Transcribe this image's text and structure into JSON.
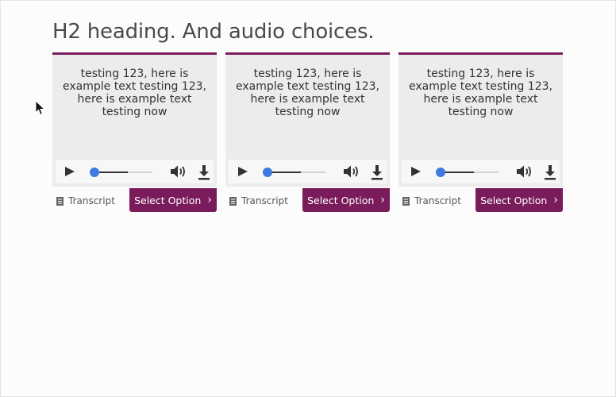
{
  "heading": "H2 heading. And audio choices.",
  "accent_color": "#7a1c5c",
  "progress_color": "#3d7be0",
  "options": [
    {
      "text": "testing 123, here is example text testing 123, here is example text testing now",
      "transcript_label": "Transcript",
      "select_label": "Select Option",
      "chevron": "›"
    },
    {
      "text": "testing 123, here is example text testing 123, here is example text testing now",
      "transcript_label": "Transcript",
      "select_label": "Select Option",
      "chevron": "›"
    },
    {
      "text": "testing 123, here is example text testing 123, here is example text testing now",
      "transcript_label": "Transcript",
      "select_label": "Select Option",
      "chevron": "›"
    }
  ],
  "icons": {
    "play": "play-icon",
    "volume": "volume-icon",
    "download": "download-icon",
    "transcript": "document-icon",
    "chevron": "chevron-right-icon",
    "cursor": "mouse-cursor-icon"
  },
  "player": {
    "progress_fraction": 0.0,
    "volume_fraction": 0.6
  }
}
